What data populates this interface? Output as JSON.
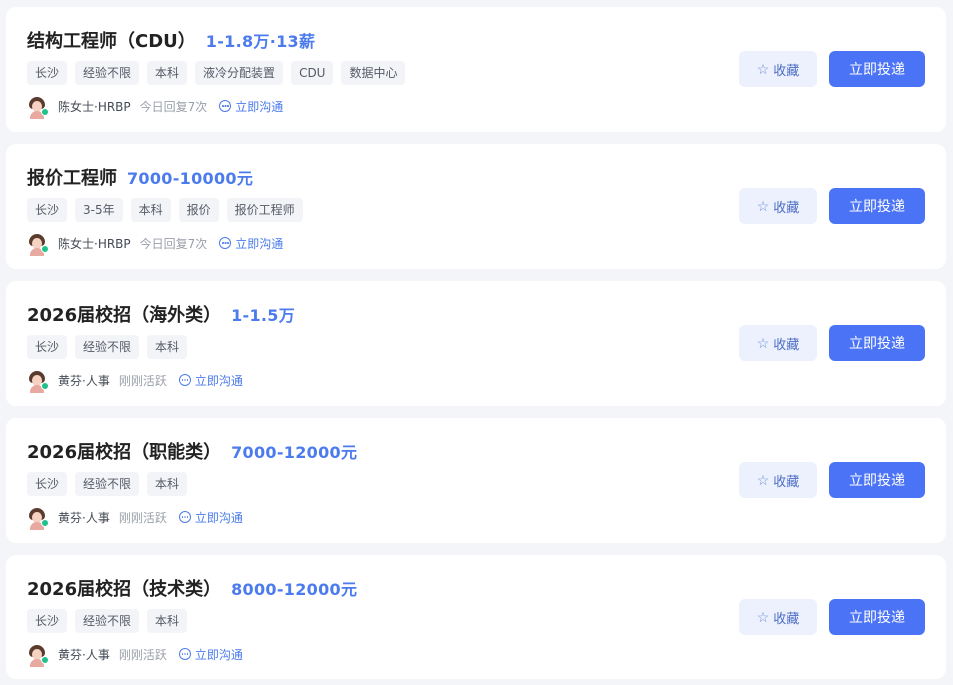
{
  "jobs": [
    {
      "title": "结构工程师（CDU）",
      "salary": "1-1.8万·13薪",
      "tags": [
        "长沙",
        "经验不限",
        "本科",
        "液冷分配装置",
        "CDU",
        "数据中心"
      ],
      "recruiter": "陈女士·HRBP",
      "status": "今日回复7次",
      "chat_label": "立即沟通",
      "fav_label": "收藏",
      "apply_label": "立即投递"
    },
    {
      "title": "报价工程师",
      "salary": "7000-10000元",
      "tags": [
        "长沙",
        "3-5年",
        "本科",
        "报价",
        "报价工程师"
      ],
      "recruiter": "陈女士·HRBP",
      "status": "今日回复7次",
      "chat_label": "立即沟通",
      "fav_label": "收藏",
      "apply_label": "立即投递"
    },
    {
      "title": "2026届校招（海外类）",
      "salary": "1-1.5万",
      "tags": [
        "长沙",
        "经验不限",
        "本科"
      ],
      "recruiter": "黄芬·人事",
      "status": "刚刚活跃",
      "chat_label": "立即沟通",
      "fav_label": "收藏",
      "apply_label": "立即投递"
    },
    {
      "title": "2026届校招（职能类）",
      "salary": "7000-12000元",
      "tags": [
        "长沙",
        "经验不限",
        "本科"
      ],
      "recruiter": "黄芬·人事",
      "status": "刚刚活跃",
      "chat_label": "立即沟通",
      "fav_label": "收藏",
      "apply_label": "立即投递"
    },
    {
      "title": "2026届校招（技术类）",
      "salary": "8000-12000元",
      "tags": [
        "长沙",
        "经验不限",
        "本科"
      ],
      "recruiter": "黄芬·人事",
      "status": "刚刚活跃",
      "chat_label": "立即沟通",
      "fav_label": "收藏",
      "apply_label": "立即投递"
    }
  ],
  "icons": {
    "favorite": "star-icon",
    "chat": "chat-bubble-icon",
    "online": "online-status-dot"
  },
  "colors": {
    "salary": "#4b7bec",
    "apply_button": "#4b73f5",
    "favorite_button_bg": "#ecf1fd",
    "online_dot": "#1fc28a"
  }
}
